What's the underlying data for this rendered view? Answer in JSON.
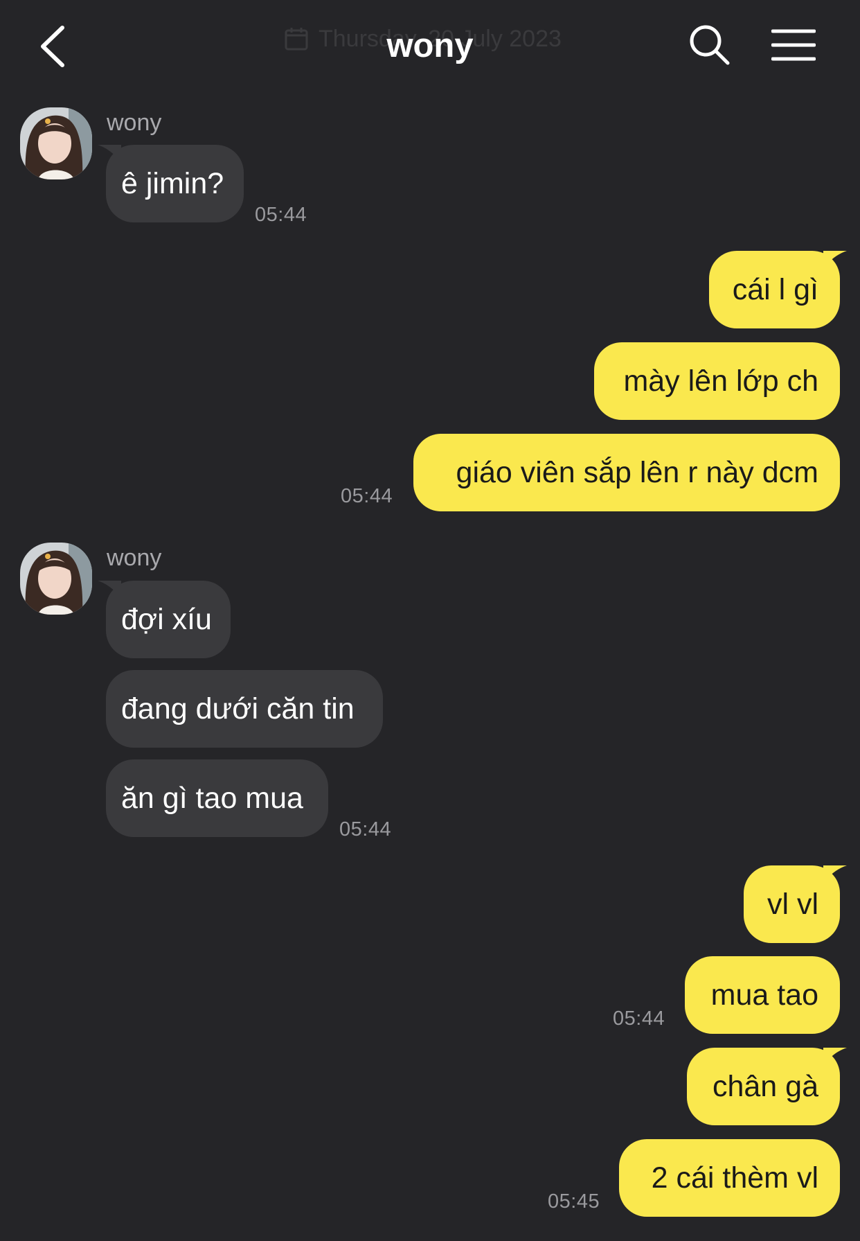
{
  "header": {
    "title": "wony",
    "date_overlay": "Thursday, 20 July 2023"
  },
  "groups": [
    {
      "sender": "wony",
      "messages": [
        "ê jimin?"
      ],
      "time": "05:44"
    },
    {
      "messages": [
        "cái l gì",
        "mày lên lớp ch",
        "giáo viên sắp lên r này dcm"
      ],
      "time": "05:44"
    },
    {
      "sender": "wony",
      "messages": [
        "đợi xíu",
        "đang dưới căn tin",
        "ăn gì tao mua"
      ],
      "time": "05:44"
    },
    {
      "messages": [
        "vl vl",
        "mua tao"
      ],
      "time": "05:44"
    },
    {
      "messages": [
        "chân gà",
        "2 cái thèm vl"
      ],
      "time": "05:45"
    }
  ],
  "colors": {
    "background": "#252528",
    "incoming_bubble": "#3a3a3d",
    "outgoing_bubble": "#fae84e"
  },
  "icons": [
    "back-arrow",
    "search",
    "hamburger-menu",
    "calendar"
  ]
}
